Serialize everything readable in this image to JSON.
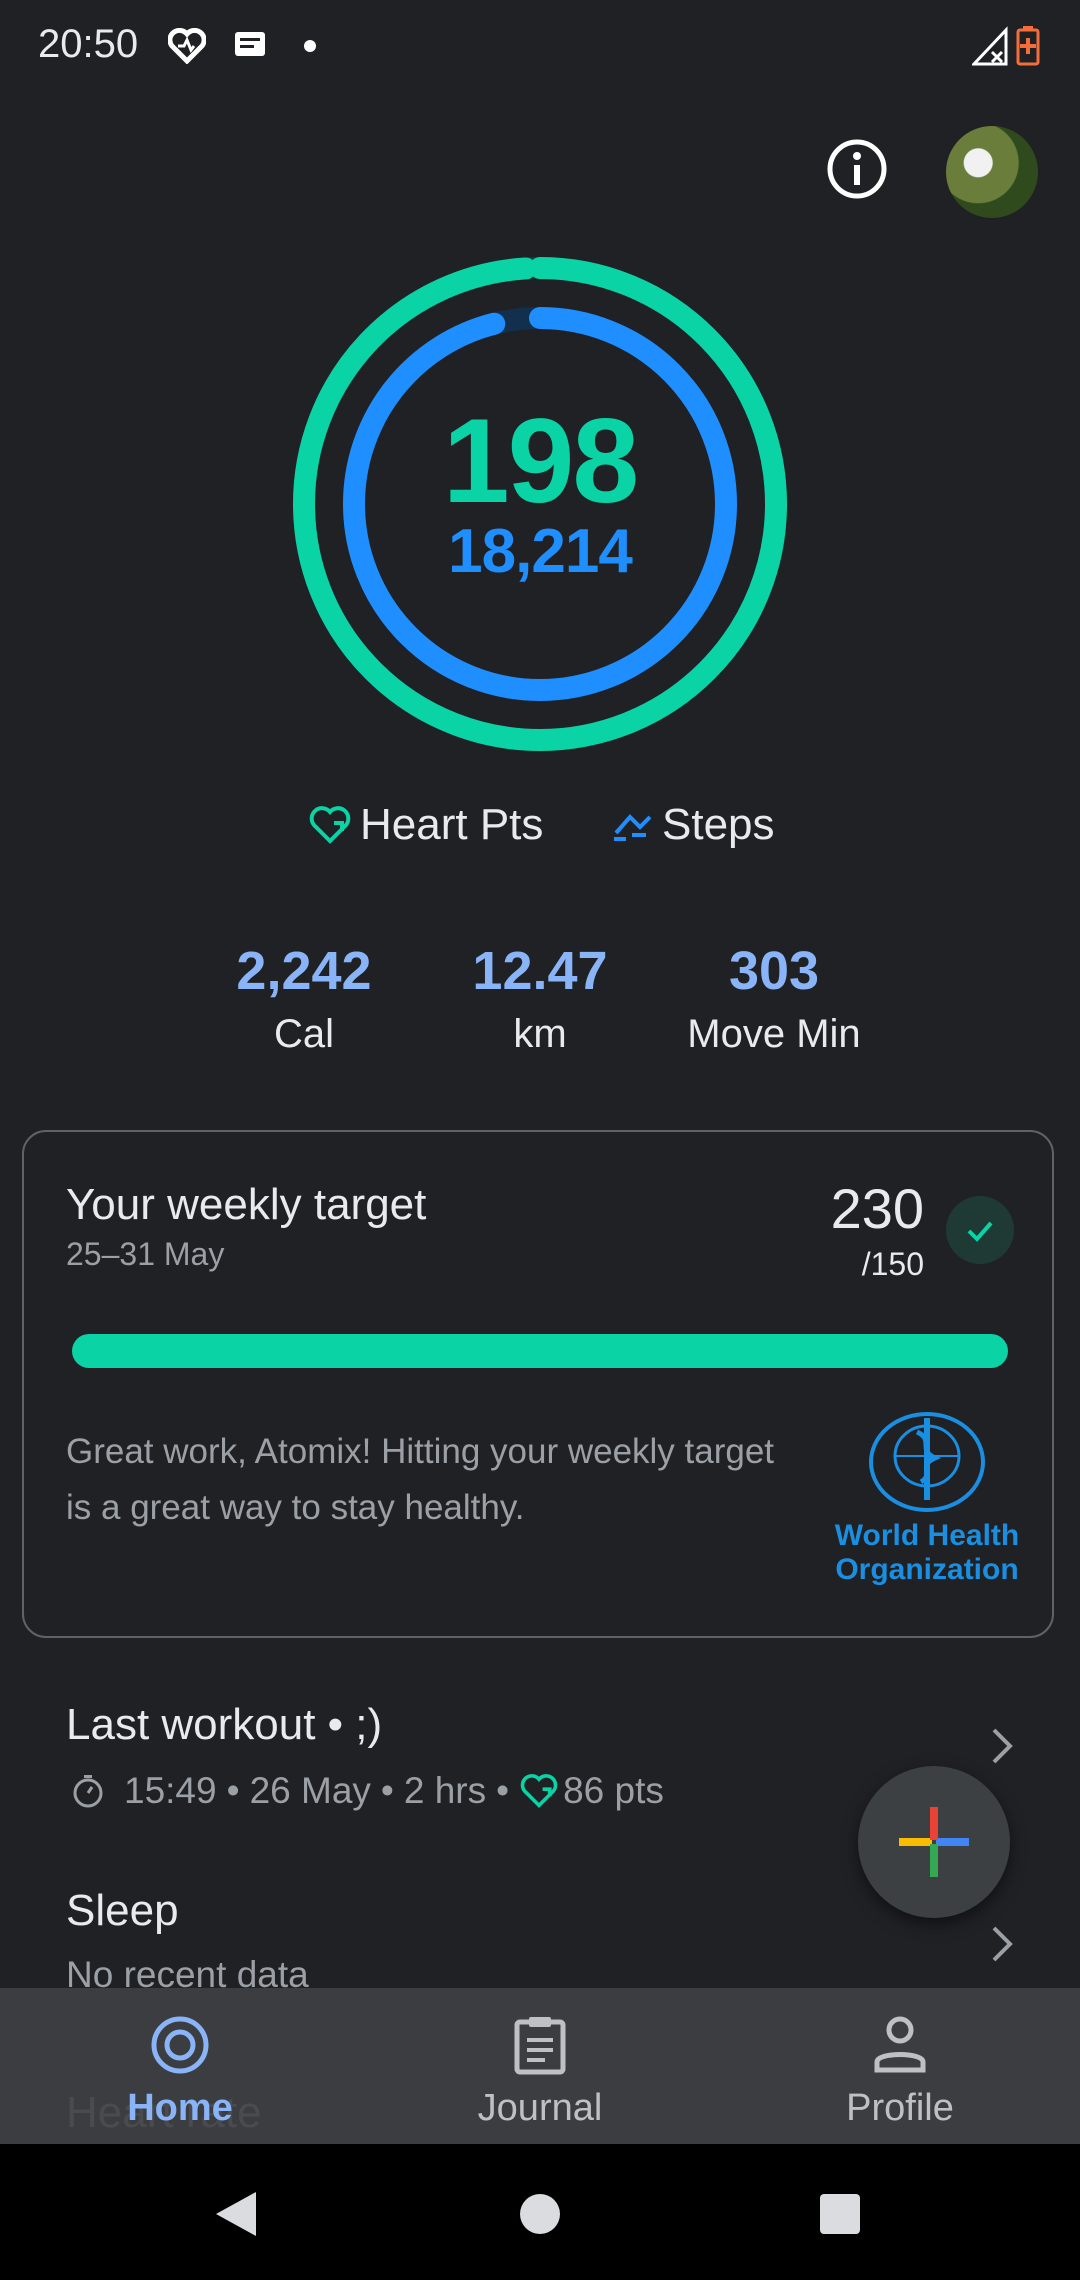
{
  "status_bar": {
    "time": "20:50"
  },
  "rings": {
    "heart_points": "198",
    "steps": "18,214",
    "heart_points_progress": 0.99,
    "steps_progress": 0.96,
    "heart_color": "#0ad3a6",
    "steps_color": "#1f8fff"
  },
  "legend": {
    "heart_label": "Heart Pts",
    "steps_label": "Steps"
  },
  "metrics": [
    {
      "value": "2,242",
      "label": "Cal"
    },
    {
      "value": "12.47",
      "label": "km"
    },
    {
      "value": "303",
      "label": "Move Min"
    }
  ],
  "weekly_card": {
    "title": "Your weekly target",
    "date_range": "25–31 May",
    "score": "230",
    "target": "/150",
    "progress": 1.0,
    "message": "Great work, Atomix! Hitting your weekly target is a great way to stay healthy.",
    "logo_line1": "World Health",
    "logo_line2": "Organization"
  },
  "last_workout": {
    "title": "Last workout • ;)",
    "time": "15:49",
    "date": "26 May",
    "duration": "2 hrs",
    "points": "86 pts",
    "sep": "•"
  },
  "sleep": {
    "title": "Sleep",
    "subtitle": "No recent data"
  },
  "heart_rate": {
    "title": "Heart rate"
  },
  "bottom_nav": [
    {
      "label": "Home",
      "active": true
    },
    {
      "label": "Journal",
      "active": false
    },
    {
      "label": "Profile",
      "active": false
    }
  ],
  "colors": {
    "accent_blue": "#8ab4f8",
    "background": "#202124"
  }
}
